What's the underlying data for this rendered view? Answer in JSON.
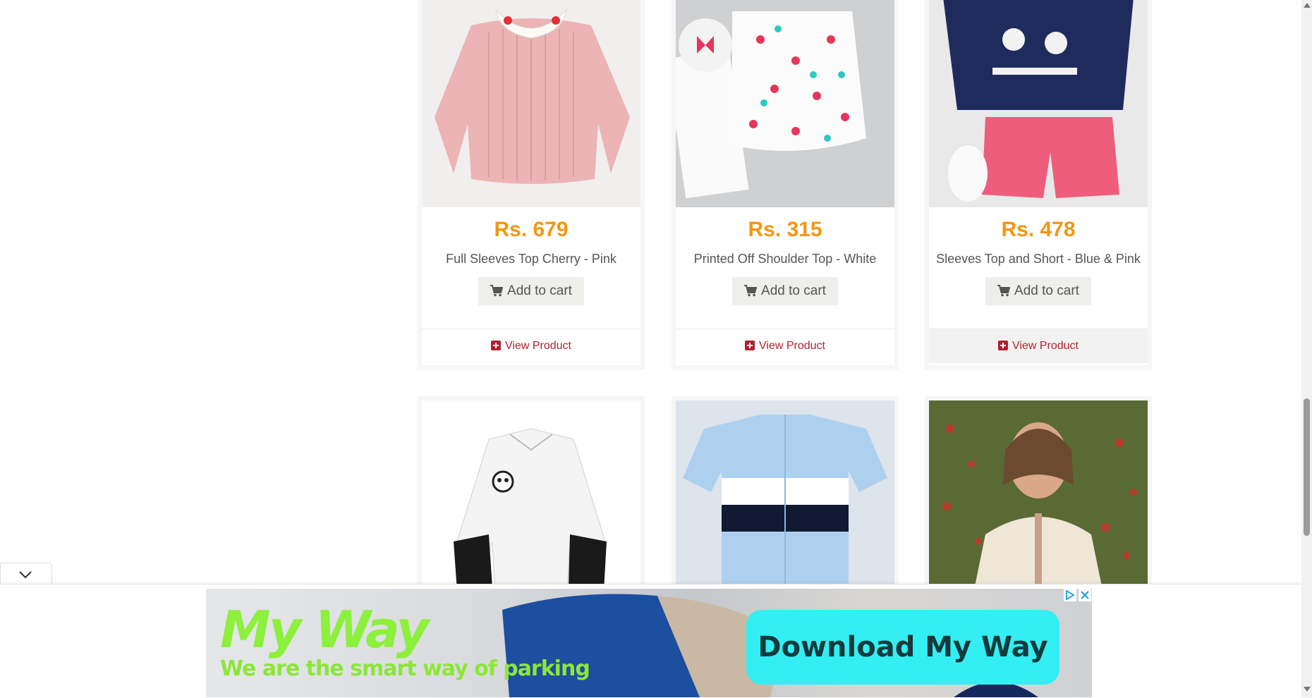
{
  "products": [
    {
      "price": "Rs. 679",
      "name": "Full Sleeves Top Cherry - Pink",
      "cart_label": "Add to cart",
      "view_label": "View Product"
    },
    {
      "price": "Rs. 315",
      "name": "Printed Off Shoulder Top - White",
      "cart_label": "Add to cart",
      "view_label": "View Product"
    },
    {
      "price": "Rs. 478",
      "name": "Sleeves Top and Short - Blue & Pink",
      "cart_label": "Add to cart",
      "view_label": "View Product"
    }
  ],
  "ad": {
    "title": "My Way",
    "tagline": "We are the smart way of parking",
    "cta": "Download My Way"
  },
  "colors": {
    "price": "#f5960f",
    "view_link": "#b21f2d",
    "ad_title": "#8cf03c",
    "ad_cta_bg": "#33eef3"
  },
  "icons": {
    "cart": "cart-icon",
    "view": "plus-square-icon",
    "ad_info": "adchoices-icon",
    "ad_close": "close-icon",
    "ad_collapse": "chevron-down-icon"
  }
}
